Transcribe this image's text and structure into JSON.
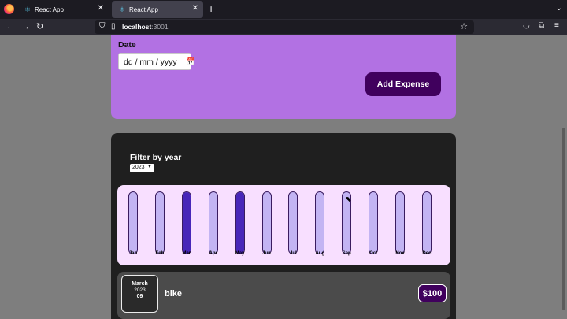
{
  "browser": {
    "tabs": [
      {
        "label": "React App"
      },
      {
        "label": "React App"
      }
    ],
    "url_host": "localhost",
    "url_port": ":3001"
  },
  "form": {
    "date_label": "Date",
    "date_placeholder": "dd / mm / yyyy",
    "submit_label": "Add Expense"
  },
  "filter": {
    "label": "Filter by year",
    "selected_year": "2023"
  },
  "chart_data": {
    "type": "bar",
    "categories": [
      "Jan",
      "Feb",
      "Mar",
      "Apr",
      "May",
      "Jun",
      "Jul",
      "Aug",
      "Sep",
      "Oct",
      "Nov",
      "Dec"
    ],
    "values": [
      0,
      0,
      1,
      0,
      1,
      0,
      0,
      0,
      0,
      0,
      0,
      0
    ],
    "ylim": [
      0,
      1
    ]
  },
  "expenses": [
    {
      "month": "March",
      "year": "2023",
      "day": "09",
      "title": "bike",
      "amount": "$100"
    }
  ],
  "colors": {
    "form_bg": "#b271e3",
    "button_bg": "#40005d",
    "chart_bg": "#f8dfff",
    "bar_fill": "#4826b9",
    "bar_empty": "#c3b4f3",
    "panel_bg": "#1f1f1f"
  }
}
